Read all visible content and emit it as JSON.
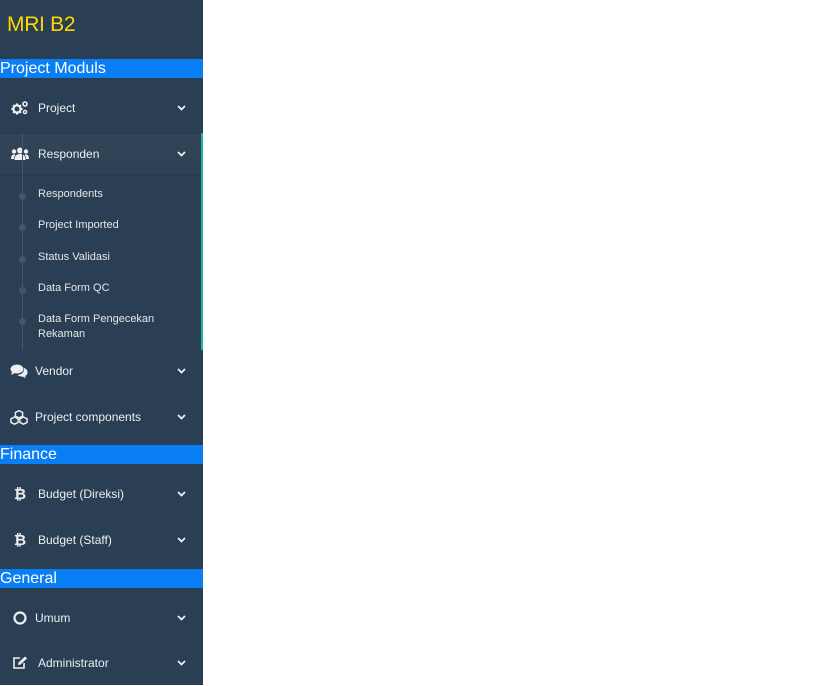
{
  "brand": {
    "title": "MRI B2"
  },
  "sections": {
    "project_moduls": "Project Moduls",
    "finance": "Finance",
    "general": "General"
  },
  "menu": {
    "project": "Project",
    "responden": "Responden",
    "vendor": "Vendor",
    "project_components": "Project components",
    "budget_direksi": "Budget (Direksi)",
    "budget_staff": "Budget (Staff)",
    "umum": "Umum",
    "administrator": "Administrator"
  },
  "responden_submenu": [
    "Respondents",
    "Project Imported",
    "Status Validasi",
    "Data Form QC",
    "Data Form Pengecekan Rekaman"
  ],
  "colors": {
    "sidebar": "#2a3f54",
    "section_header": "#0a7ff5",
    "brand": "#ffd700",
    "active_accent": "#1abb9c"
  },
  "icons": {
    "project": "cogs-icon",
    "responden": "users-icon",
    "vendor": "comments-icon",
    "project_components": "cubes-icon",
    "budget_direksi": "bitcoin-icon",
    "budget_staff": "bitcoin-icon",
    "umum": "circle-icon",
    "administrator": "edit-icon"
  }
}
